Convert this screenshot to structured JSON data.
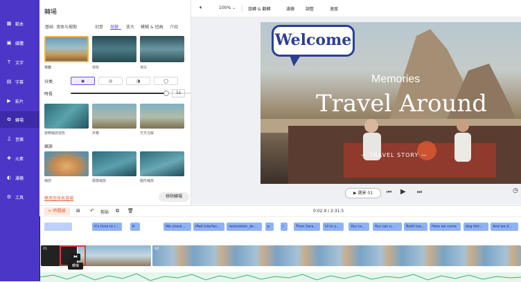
{
  "sidebar": {
    "items": [
      {
        "label": "範本",
        "icon": "template-icon"
      },
      {
        "label": "媒體",
        "icon": "media-icon"
      },
      {
        "label": "文字",
        "icon": "text-icon"
      },
      {
        "label": "字幕",
        "icon": "subtitle-icon"
      },
      {
        "label": "影片",
        "icon": "video-icon"
      },
      {
        "label": "轉場",
        "icon": "transition-icon"
      },
      {
        "label": "音樂",
        "icon": "music-icon"
      },
      {
        "label": "元素",
        "icon": "elements-icon"
      },
      {
        "label": "濾鏡",
        "icon": "filter-icon"
      },
      {
        "label": "工具",
        "icon": "tools-icon"
      }
    ]
  },
  "panel": {
    "title": "轉場",
    "tabs": [
      "基础",
      "溶体与褪期",
      "创意",
      "渐變",
      "放大",
      "模糊 & 扭曲",
      "介绍"
    ],
    "row1_captions": [
      "漸變",
      "褪色",
      "漸白"
    ],
    "direction_label": "分类",
    "duration_label": "時長",
    "duration_value": "1s",
    "row2_captions": [
      "旋轉縮放褪色",
      "折離",
      "交叉溶解"
    ],
    "zoom_section": "縮放",
    "row3_captions": [
      "縮放",
      "層層縮放",
      "圖形縮放"
    ],
    "apply_all": "應用至所有過場",
    "remove_button": "移除轉場"
  },
  "toolbar": {
    "zoom": "100%",
    "items": [
      "旋轉 & 翻轉",
      "濾鏡",
      "調整",
      "速度"
    ]
  },
  "preview": {
    "welcome": "Welcome",
    "line1": "Memories",
    "line2": "Travel Around",
    "line3": "TRAVEL STORY",
    "clip_button": "選景 01"
  },
  "timeline": {
    "split_label": "時間線",
    "cut_label": "剪貼",
    "time_current": "0:02.9",
    "time_total": "2:31.5",
    "subtitles": [
      "It's time to r...",
      "R",
      "We check...",
      "iPad interfac...",
      "restoration_de...",
      "p",
      "i",
      "Then Sara...",
      "Ul to y...",
      "You ca...",
      "You can u...",
      "Brett too...",
      "Here we come",
      "dog fetc...",
      "And we d..."
    ],
    "clip_labels": [
      "01",
      "02"
    ],
    "transition_tooltip": "轉場"
  },
  "colors": {
    "accent": "#6450e6",
    "sidebar": "#4c36c8",
    "chip": "#8eb2f8"
  }
}
